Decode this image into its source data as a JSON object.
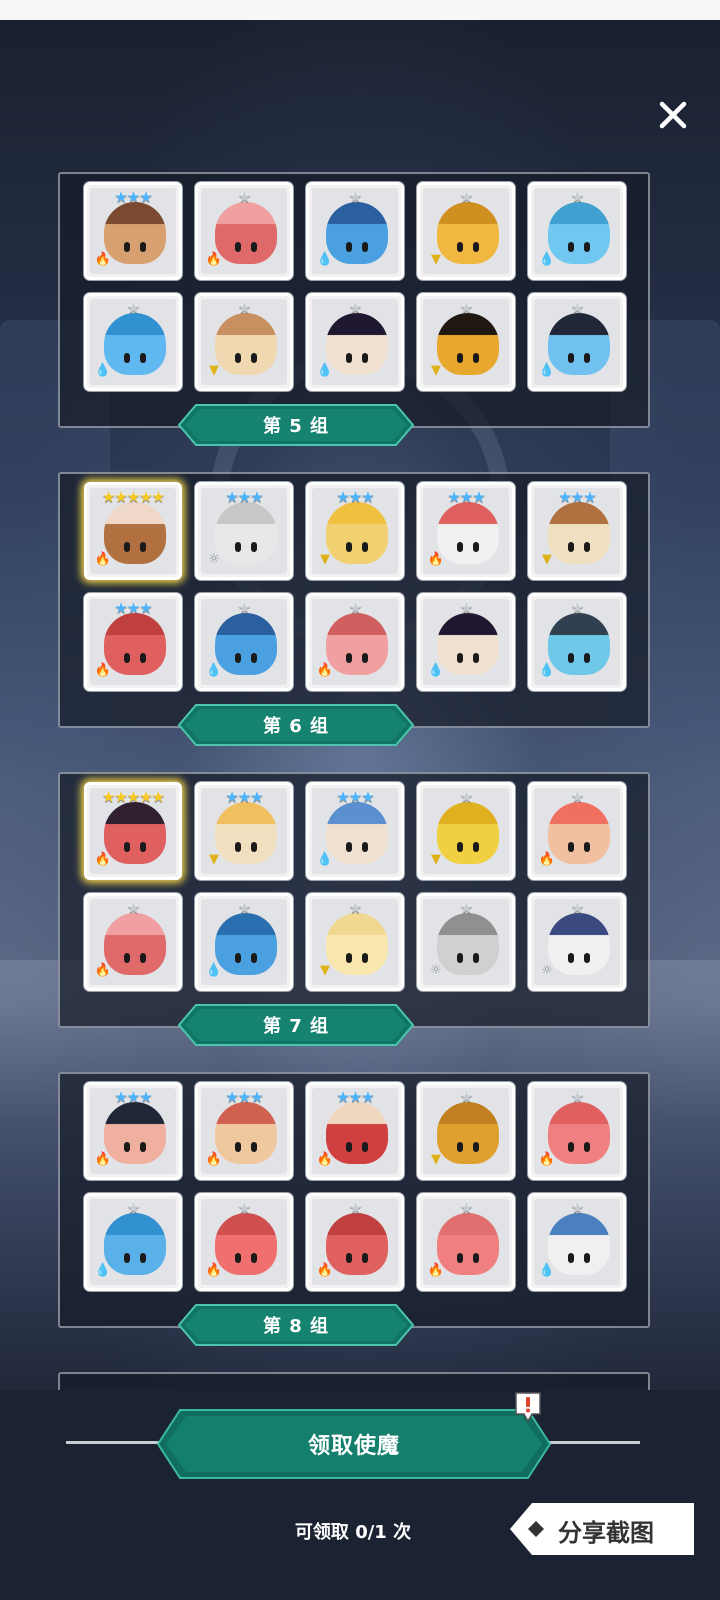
{
  "colors": {
    "teal": "#137a6a",
    "teal_light": "#1e9a86",
    "fire": "#e0442c",
    "water": "#2e8fe6",
    "earth": "#e0b21a",
    "light": "#8a8f98",
    "star_silver": "#c8ccd4",
    "star_blue": "#4bb4ff",
    "star_gold": "#f7c81e"
  },
  "close_icon": "close-icon",
  "groups": [
    {
      "label": "第 5 组",
      "cards": [
        {
          "stars": 3,
          "element": "fire",
          "color": "#d8a070",
          "hair": "#7a4a30"
        },
        {
          "stars": 1,
          "element": "fire",
          "color": "#e06a6a",
          "hair": "#f0a0a0"
        },
        {
          "stars": 1,
          "element": "water",
          "color": "#4aa0e0",
          "hair": "#2a60a0"
        },
        {
          "stars": 1,
          "element": "earth",
          "color": "#f0b840",
          "hair": "#d09020"
        },
        {
          "stars": 1,
          "element": "water",
          "color": "#70c8f0",
          "hair": "#40a0d0"
        },
        {
          "stars": 1,
          "element": "water",
          "color": "#60b8f0",
          "hair": "#3090d0"
        },
        {
          "stars": 1,
          "element": "earth",
          "color": "#f0d8b0",
          "hair": "#c89060"
        },
        {
          "stars": 1,
          "element": "water",
          "color": "#f0e0d0",
          "hair": "#201830"
        },
        {
          "stars": 1,
          "element": "earth",
          "color": "#e8a830",
          "hair": "#201810"
        },
        {
          "stars": 1,
          "element": "water",
          "color": "#70c0f0",
          "hair": "#202838"
        }
      ]
    },
    {
      "label": "第 6 组",
      "cards": [
        {
          "stars": 5,
          "element": "fire",
          "color": "#b07040",
          "hair": "#f0d8c8"
        },
        {
          "stars": 3,
          "element": "light",
          "color": "#e8e8e8",
          "hair": "#c8c8c8"
        },
        {
          "stars": 3,
          "element": "earth",
          "color": "#f0d070",
          "hair": "#f0c040"
        },
        {
          "stars": 3,
          "element": "fire",
          "color": "#f0f0f0",
          "hair": "#e06060"
        },
        {
          "stars": 3,
          "element": "earth",
          "color": "#f0e0c0",
          "hair": "#b07040"
        },
        {
          "stars": 3,
          "element": "fire",
          "color": "#e06060",
          "hair": "#c04040"
        },
        {
          "stars": 1,
          "element": "water",
          "color": "#4aa0e0",
          "hair": "#2a60a0"
        },
        {
          "stars": 1,
          "element": "fire",
          "color": "#f0a0a0",
          "hair": "#d06060"
        },
        {
          "stars": 1,
          "element": "water",
          "color": "#f0e0d0",
          "hair": "#201830"
        },
        {
          "stars": 1,
          "element": "water",
          "color": "#70c8e8",
          "hair": "#304050"
        }
      ]
    },
    {
      "label": "第 7 组",
      "cards": [
        {
          "stars": 5,
          "element": "fire",
          "color": "#e06060",
          "hair": "#302030"
        },
        {
          "stars": 3,
          "element": "earth",
          "color": "#f0e0c0",
          "hair": "#f0c060"
        },
        {
          "stars": 3,
          "element": "water",
          "color": "#f0e0d0",
          "hair": "#5a90d0"
        },
        {
          "stars": 1,
          "element": "earth",
          "color": "#f0d040",
          "hair": "#e0b020"
        },
        {
          "stars": 1,
          "element": "fire",
          "color": "#f0c0a0",
          "hair": "#f07060"
        },
        {
          "stars": 1,
          "element": "fire",
          "color": "#e06a6a",
          "hair": "#f0a0a0"
        },
        {
          "stars": 1,
          "element": "water",
          "color": "#4aa0e0",
          "hair": "#2a70b0"
        },
        {
          "stars": 1,
          "element": "earth",
          "color": "#f8e8b0",
          "hair": "#f0d890"
        },
        {
          "stars": 1,
          "element": "light",
          "color": "#d0d0d0",
          "hair": "#909090"
        },
        {
          "stars": 1,
          "element": "light",
          "color": "#f0f0f0",
          "hair": "#3a4a80"
        }
      ]
    },
    {
      "label": "第 8 组",
      "cards": [
        {
          "stars": 3,
          "element": "fire",
          "color": "#f0b0a0",
          "hair": "#202838"
        },
        {
          "stars": 3,
          "element": "fire",
          "color": "#f0c8a0",
          "hair": "#d06050"
        },
        {
          "stars": 3,
          "element": "fire",
          "color": "#d04040",
          "hair": "#f0d8c0"
        },
        {
          "stars": 1,
          "element": "earth",
          "color": "#e0a030",
          "hair": "#c08020"
        },
        {
          "stars": 1,
          "element": "fire",
          "color": "#f08080",
          "hair": "#e06060"
        },
        {
          "stars": 1,
          "element": "water",
          "color": "#5ab0e8",
          "hair": "#3090d0"
        },
        {
          "stars": 1,
          "element": "fire",
          "color": "#f07070",
          "hair": "#d05050"
        },
        {
          "stars": 1,
          "element": "fire",
          "color": "#e06060",
          "hair": "#c04040"
        },
        {
          "stars": 1,
          "element": "fire",
          "color": "#f08080",
          "hair": "#e07070"
        },
        {
          "stars": 1,
          "element": "water",
          "color": "#f0f0f0",
          "hair": "#4a80c0"
        }
      ]
    }
  ],
  "claim_button": {
    "label": "领取使魔"
  },
  "claim_count": {
    "text": "可领取 0/1 次"
  },
  "share_button": {
    "label": "分享截图"
  },
  "alert_icon": "alert-icon"
}
